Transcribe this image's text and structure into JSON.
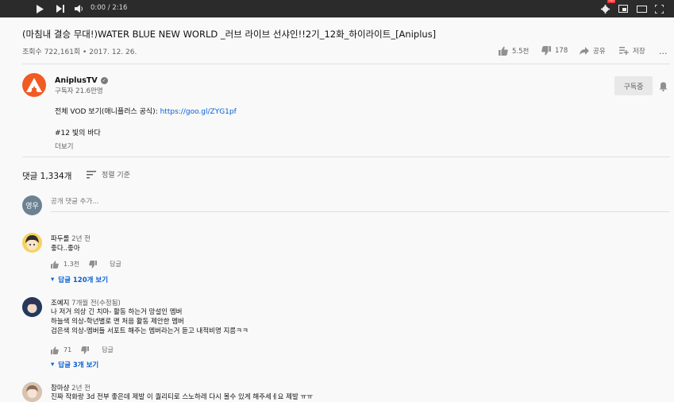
{
  "player": {
    "time": "0:00 / 2:16",
    "hd_badge": "HD"
  },
  "video": {
    "title": "(마침내 결승 무대!)WATER BLUE NEW WORLD _러브 라이브 선샤인!!2기_12화_하이라이트_[Aniplus]",
    "views_date": "조회수 722,161회 • 2017. 12. 26.",
    "likes": "5.5천",
    "dislikes": "178",
    "share_label": "공유",
    "save_label": "저장",
    "more_label": "..."
  },
  "channel": {
    "name": "AniplusTV",
    "subscribers": "구독자 21.6만명",
    "subscribe_label": "구독중"
  },
  "description": {
    "line1_text": "전체 VOD 보기(애니플러스 공식): ",
    "line1_link": "https://goo.gl/ZYG1pf",
    "line2": "#12 빛의 바다",
    "show_more": "더보기"
  },
  "comments_header": {
    "count": "댓글 1,334개",
    "sort_label": "정렬 기준"
  },
  "add_comment": {
    "avatar_text": "영우",
    "placeholder": "공개 댓글 추가..."
  },
  "comments": [
    {
      "author": "파두롤",
      "meta": "2년 전",
      "lines": [
        "좋다..좋아"
      ],
      "likes": "1.3천",
      "reply_label": "답글",
      "view_replies": "답글 120개 보기"
    },
    {
      "author": "조예지",
      "meta": "7개월 전(수정됨)",
      "lines": [
        "나 저거 의상 긴 치마- 활동 하는거 망설인 멤버",
        "하늘색 의상-학년별로 맨 처음 활동 제안한 멤버",
        "검은색 의상-멤버들 서포트 해주는 멤버라는거 듣고 내적비명 지름ㅋㅋ"
      ],
      "likes": "71",
      "reply_label": "답글",
      "view_replies": "답글 3개 보기"
    },
    {
      "author": "참마샹",
      "meta": "2년 전",
      "lines": [
        "진짜 작화랑 3d 전부 좋은데 제발 이 퀄리티로 스노하레 다시 볼수 있게 해주세ㅔ요 제발 ㅠㅠ"
      ]
    }
  ]
}
